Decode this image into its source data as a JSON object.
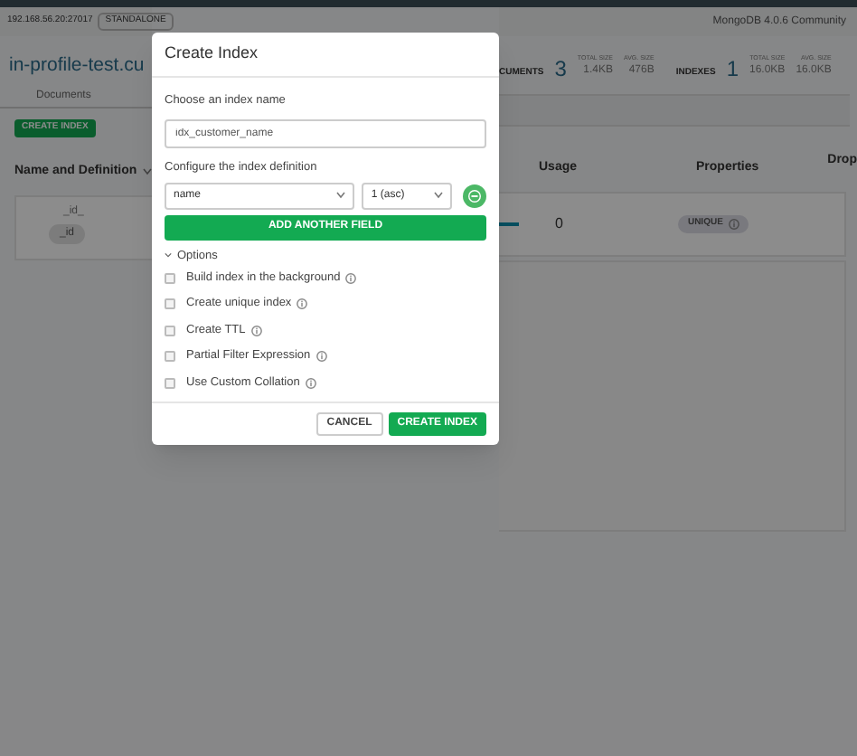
{
  "top_bar": {
    "host": "192.168.56.20:27017",
    "topology": "STANDALONE",
    "version": "MongoDB 4.0.6 Community"
  },
  "collection": {
    "title": "in-profile-test.cu",
    "tabs": [
      {
        "label": "Documents"
      }
    ]
  },
  "stats": [
    {
      "label": "CUMENTS",
      "value": "3",
      "sizes": [
        {
          "label": "TOTAL SIZE",
          "value": "1.4KB"
        },
        {
          "label": "AVG. SIZE",
          "value": "476B"
        }
      ]
    },
    {
      "label": "INDEXES",
      "value": "1",
      "sizes": [
        {
          "label": "TOTAL SIZE",
          "value": "16.0KB"
        },
        {
          "label": "AVG. SIZE",
          "value": "16.0KB"
        }
      ]
    }
  ],
  "toolbar": {
    "create_button": "CREATE INDEX"
  },
  "table": {
    "columns_left": [
      "Name and Definition"
    ],
    "columns_right": [
      "Usage",
      "Properties",
      "Drop"
    ],
    "rows": [
      {
        "name": "_id_",
        "field": "_id",
        "usage": "0",
        "property": "UNIQUE"
      }
    ]
  },
  "modal": {
    "title": "Create Index",
    "name_label": "Choose an index name",
    "name_value": "idx_customer_name",
    "definition_label": "Configure the index definition",
    "fields": [
      {
        "field": "name",
        "type": "1 (asc)"
      }
    ],
    "add_button": "ADD ANOTHER FIELD",
    "options_label": "Options",
    "options_expanded": true,
    "options": [
      {
        "label": "Build index in the background",
        "checked": false
      },
      {
        "label": "Create unique index",
        "checked": false
      },
      {
        "label": "Create TTL",
        "checked": false
      },
      {
        "label": "Partial Filter Expression",
        "checked": false
      },
      {
        "label": "Use Custom Collation",
        "checked": false
      }
    ],
    "buttons": [
      {
        "label": "CANCEL",
        "kind": "secondary"
      },
      {
        "label": "CREATE INDEX",
        "kind": "primary"
      }
    ]
  }
}
